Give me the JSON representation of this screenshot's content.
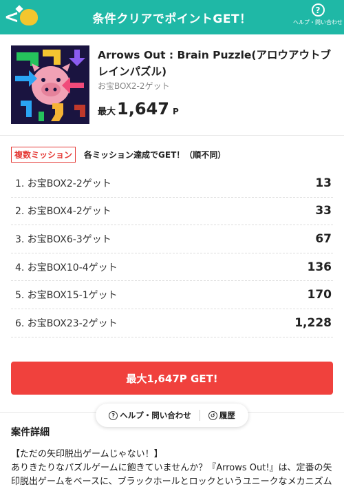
{
  "header": {
    "title": "条件クリアでポイントGET！",
    "help_label": "ヘルプ・問い合わせ",
    "back_glyph": "<",
    "help_glyph": "?"
  },
  "colors": {
    "accent": "#1fb8a6",
    "cta": "#f0413d",
    "badge": "#e53935"
  },
  "product": {
    "title": "Arrows Out : Brain Puzzle(アロウアウトブレインパズル)",
    "subtitle": "お宝BOX2-2ゲット",
    "max_label": "最大",
    "max_points": "1,647",
    "unit": "P"
  },
  "missions": {
    "badge": "複数ミッション",
    "note": "各ミッション達成でGET！（順不同）",
    "items": [
      {
        "name": "1. お宝BOX2-2ゲット",
        "points": "13"
      },
      {
        "name": "2. お宝BOX4-2ゲット",
        "points": "33"
      },
      {
        "name": "3. お宝BOX6-3ゲット",
        "points": "67"
      },
      {
        "name": "4. お宝BOX10-4ゲット",
        "points": "136"
      },
      {
        "name": "5. お宝BOX15-1ゲット",
        "points": "170"
      },
      {
        "name": "6. お宝BOX23-2ゲット",
        "points": "1,228"
      }
    ]
  },
  "cta": {
    "label": "最大1,647P GET!"
  },
  "floating_bar": {
    "help": "ヘルプ・問い合わせ",
    "history": "履歴"
  },
  "detail": {
    "title": "案件詳細",
    "line1": "【ただの矢印脱出ゲームじゃない！】",
    "line2": "ありきたりなパズルゲームに飽きていませんか？『Arrows Out!』は、定番の矢印脱出ゲームをベースに、ブラックホールとロックというユニークなメカニズム"
  }
}
